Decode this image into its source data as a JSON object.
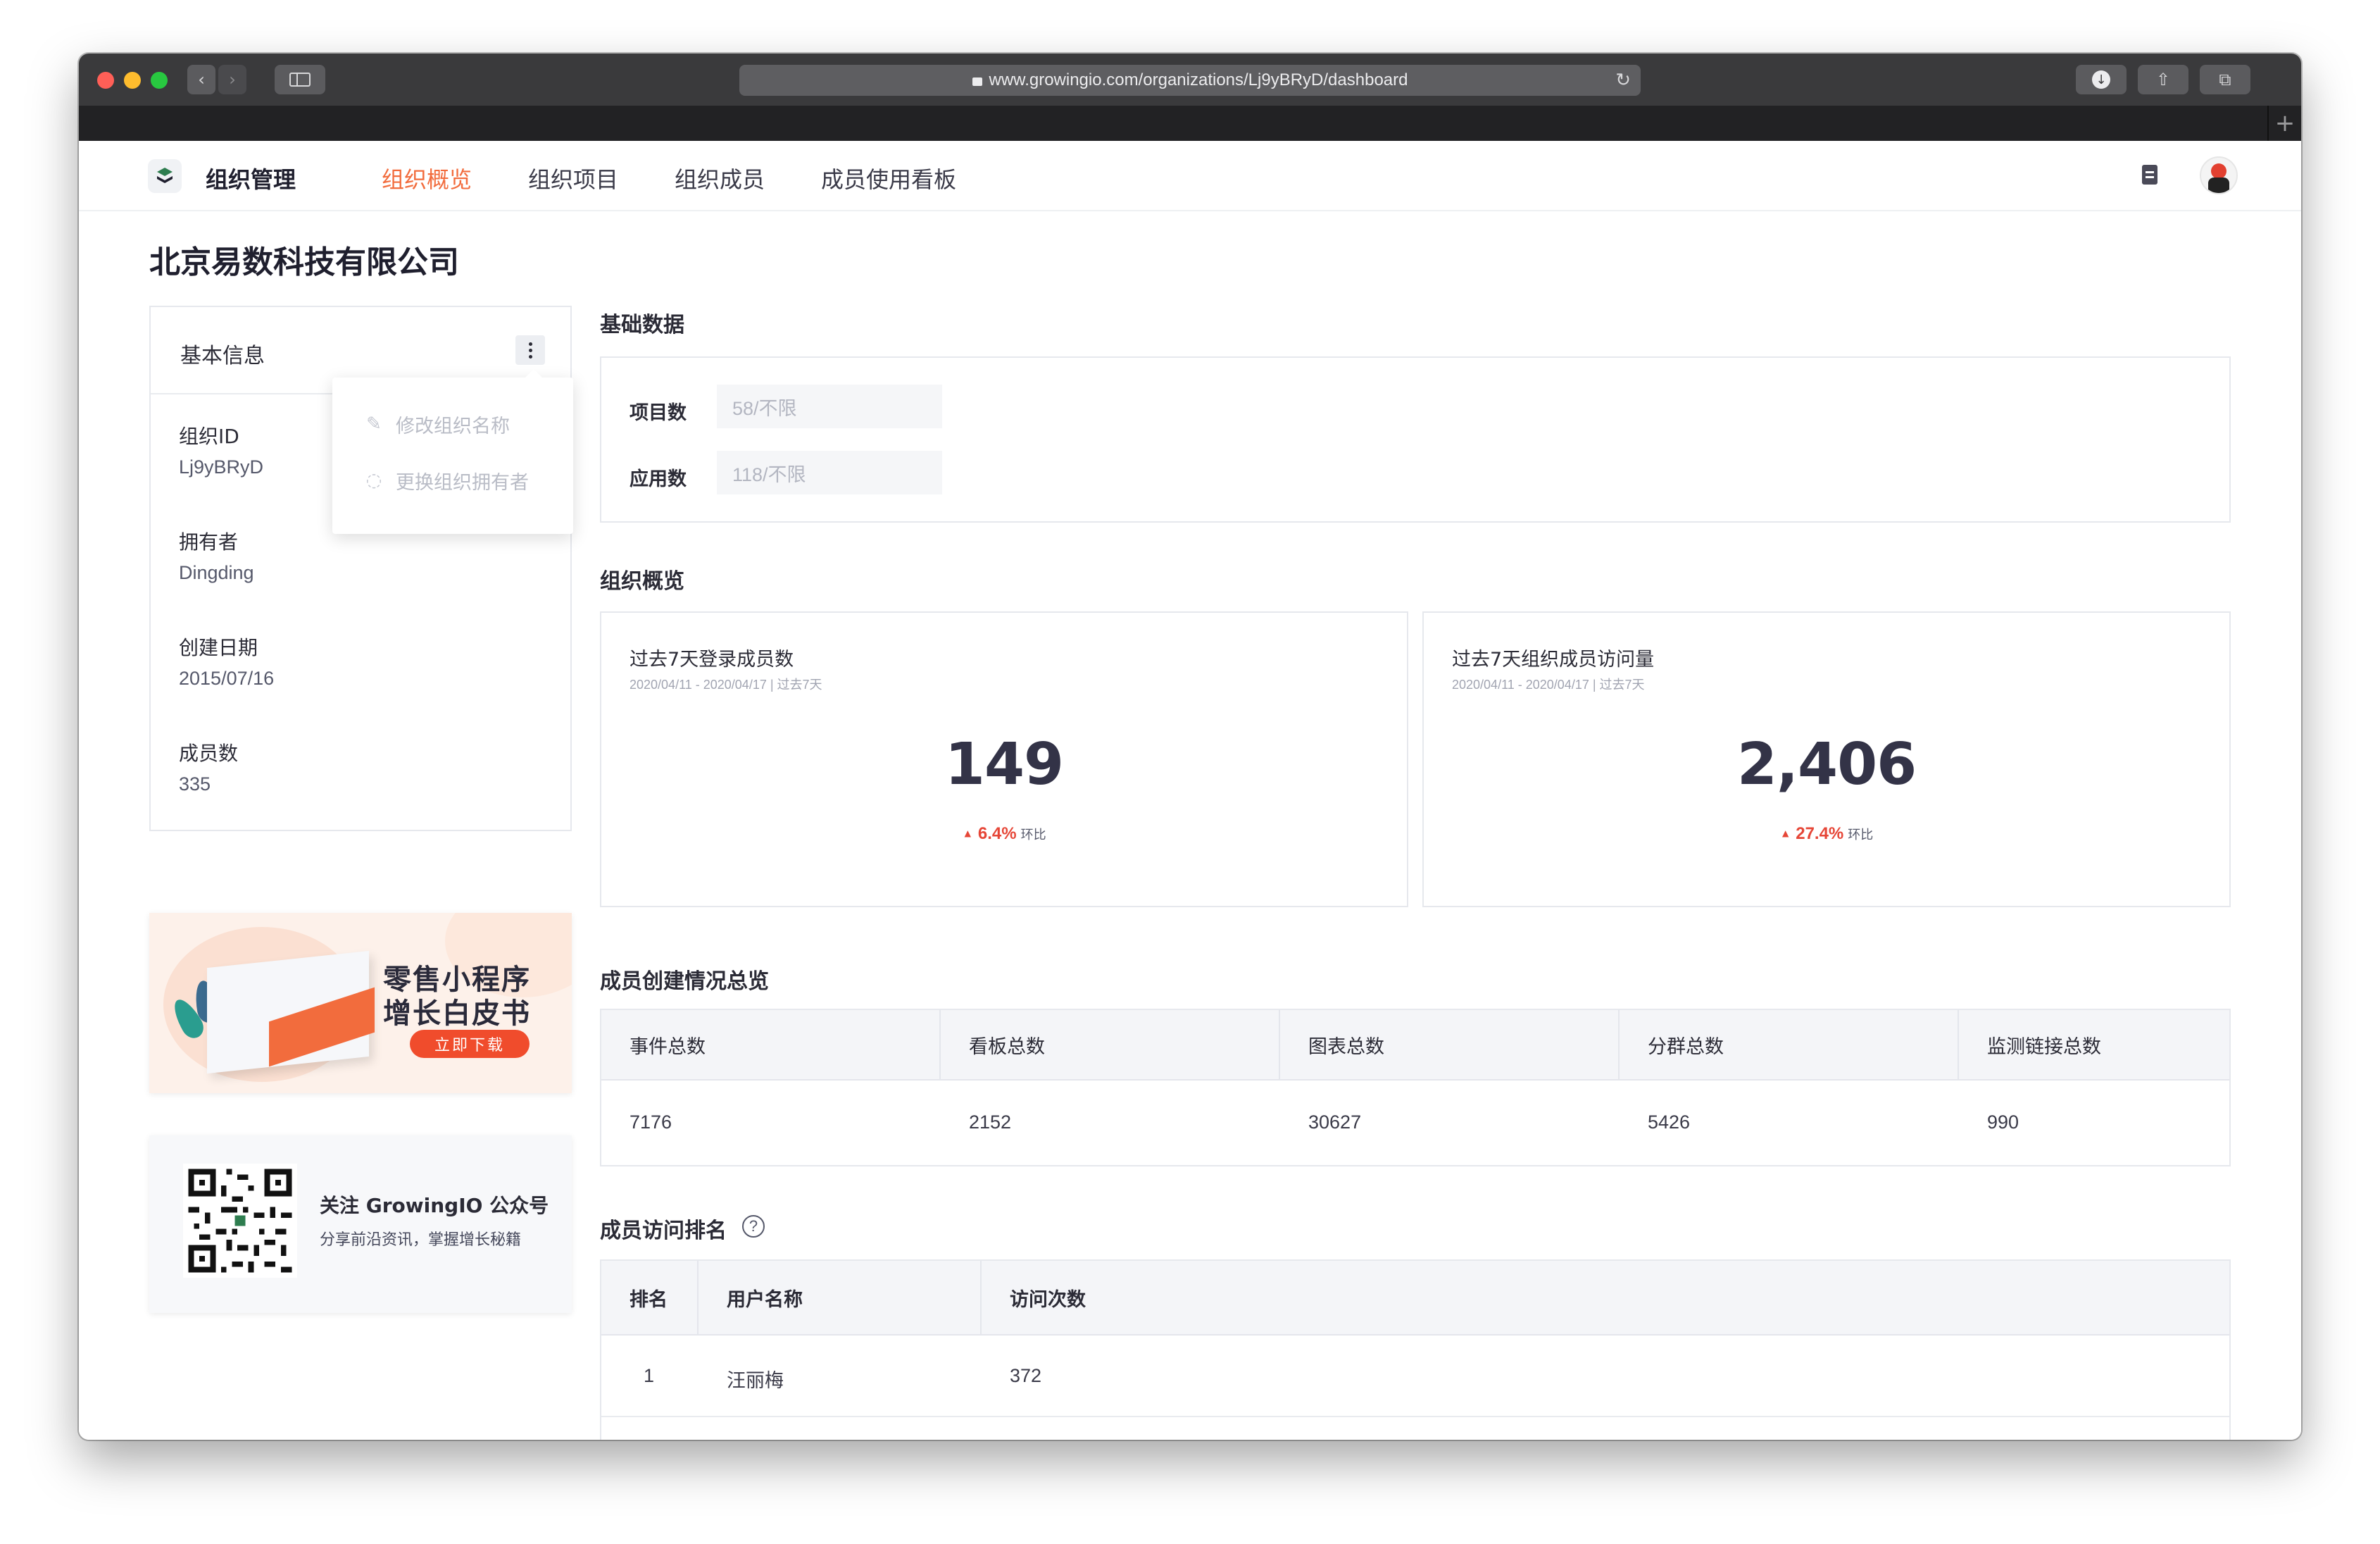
{
  "browser": {
    "url": "www.growingio.com/organizations/Lj9yBRyD/dashboard"
  },
  "nav": {
    "brand": "组织管理",
    "tabs": [
      {
        "label": "组织概览",
        "active": true
      },
      {
        "label": "组织项目",
        "active": false
      },
      {
        "label": "组织成员",
        "active": false
      },
      {
        "label": "成员使用看板",
        "active": false
      }
    ]
  },
  "page": {
    "title": "北京易数科技有限公司"
  },
  "basic_info": {
    "title": "基本信息",
    "fields": [
      {
        "label": "组织ID",
        "value": "Lj9yBRyD"
      },
      {
        "label": "拥有者",
        "value": "Dingding"
      },
      {
        "label": "创建日期",
        "value": "2015/07/16"
      },
      {
        "label": "成员数",
        "value": "335"
      }
    ],
    "menu": [
      {
        "label": "修改组织名称",
        "icon": "pencil-icon"
      },
      {
        "label": "更换组织拥有者",
        "icon": "refresh-icon"
      }
    ]
  },
  "banner": {
    "line1": "零售小程序",
    "line2": "增长白皮书",
    "button": "立即下载"
  },
  "wechat": {
    "title": "关注 GrowingIO 公众号",
    "subtitle": "分享前沿资讯，掌握增长秘籍"
  },
  "basic_data": {
    "title": "基础数据",
    "rows": [
      {
        "label": "项目数",
        "value": "58/不限"
      },
      {
        "label": "应用数",
        "value": "118/不限"
      }
    ]
  },
  "overview": {
    "title": "组织概览",
    "cards": [
      {
        "title": "过去7天登录成员数",
        "range": "2020/04/11 - 2020/04/17 | 过去7天",
        "value": "149",
        "change": "6.4%",
        "change_label": "环比"
      },
      {
        "title": "过去7天组织成员访问量",
        "range": "2020/04/11 - 2020/04/17 | 过去7天",
        "value": "2,406",
        "change": "27.4%",
        "change_label": "环比"
      }
    ]
  },
  "creation": {
    "title": "成员创建情况总览",
    "headers": [
      "事件总数",
      "看板总数",
      "图表总数",
      "分群总数",
      "监测链接总数"
    ],
    "values": [
      "7176",
      "2152",
      "30627",
      "5426",
      "990"
    ]
  },
  "ranking": {
    "title": "成员访问排名",
    "headers": [
      "排名",
      "用户名称",
      "访问次数"
    ],
    "rows": [
      {
        "rank": "1",
        "name": "汪丽梅",
        "visits": "372"
      }
    ]
  },
  "colors": {
    "accent": "#f26c3d",
    "up": "#e64637"
  }
}
